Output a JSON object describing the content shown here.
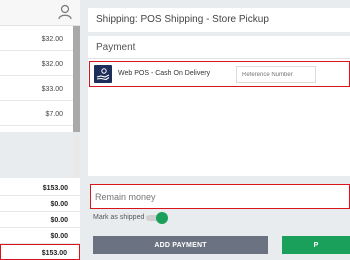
{
  "left_panel": {
    "items": [
      {
        "price": "$32.00"
      },
      {
        "price": "$32.00"
      },
      {
        "price": "$33.00"
      },
      {
        "price": "$7.00"
      }
    ],
    "totals": [
      {
        "value": "$153.00"
      },
      {
        "value": "$0.00"
      },
      {
        "value": "$0.00"
      },
      {
        "value": "$0.00"
      },
      {
        "value": "$153.00"
      }
    ]
  },
  "shipping": {
    "label": "Shipping: POS Shipping - Store Pickup"
  },
  "payment": {
    "title": "Payment",
    "method_label": "Web POS - Cash On Delivery",
    "reference_placeholder": "Reference Number"
  },
  "remain": {
    "placeholder": "Remain money"
  },
  "mark_shipped": {
    "label": "Mark as shipped",
    "checked": true
  },
  "buttons": {
    "add_payment": "ADD PAYMENT",
    "right_button": "P"
  },
  "colors": {
    "highlight": "#d9141b",
    "green": "#1aa05a",
    "gray_button": "#6b7382",
    "payment_icon_bg": "#1d2e5a"
  },
  "icons": {
    "user": "user-icon",
    "payment_method": "cash-hand-icon"
  }
}
